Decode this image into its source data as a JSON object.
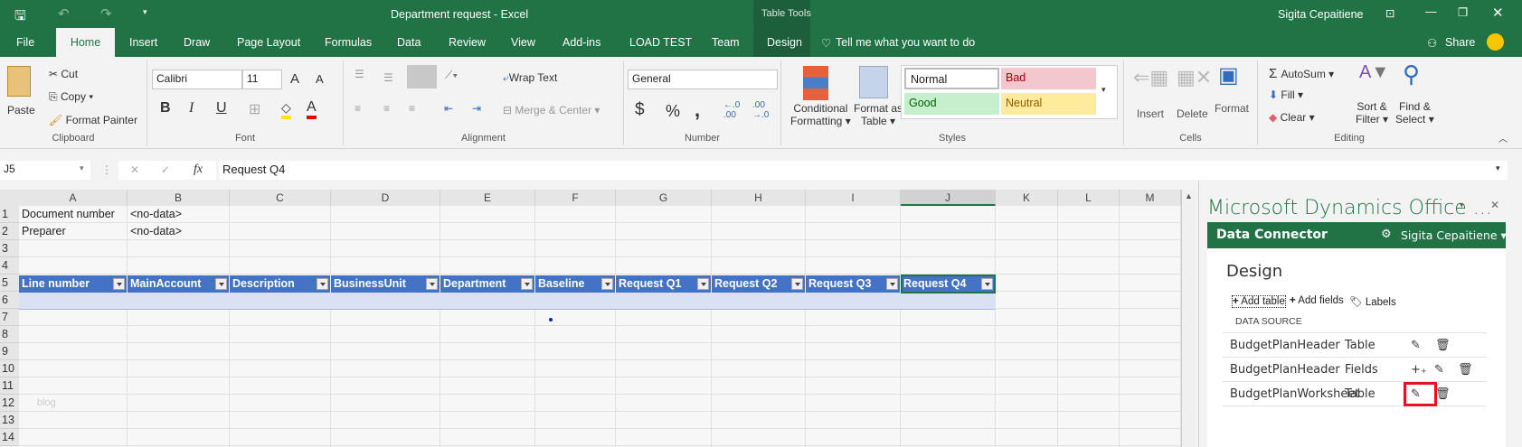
{
  "window": {
    "title": "Department request  -  Excel",
    "context_tab_group": "Table Tools",
    "user": "Sigita Cepaitiene",
    "share": "Share"
  },
  "tabs": [
    "File",
    "Home",
    "Insert",
    "Draw",
    "Page Layout",
    "Formulas",
    "Data",
    "Review",
    "View",
    "Add-ins",
    "LOAD TEST",
    "Team",
    "Design"
  ],
  "tell_me": "Tell me what you want to do",
  "ribbon": {
    "clipboard": {
      "label": "Clipboard",
      "paste": "Paste",
      "cut": "Cut",
      "copy": "Copy",
      "format_painter": "Format Painter"
    },
    "font": {
      "label": "Font",
      "name": "Calibri",
      "size": "11",
      "bold": "B",
      "italic": "I",
      "underline": "U"
    },
    "alignment": {
      "label": "Alignment",
      "wrap": "Wrap Text",
      "merge": "Merge & Center"
    },
    "number": {
      "label": "Number",
      "format": "General",
      "currency": "$",
      "percent": "%",
      "comma": ","
    },
    "styles": {
      "label": "Styles",
      "conditional": "Conditional",
      "conditional2": "Formatting",
      "format_table": "Format as",
      "format_table2": "Table",
      "normal": "Normal",
      "bad": "Bad",
      "good": "Good",
      "neutral": "Neutral"
    },
    "cells": {
      "label": "Cells",
      "insert": "Insert",
      "delete": "Delete",
      "format": "Format"
    },
    "editing": {
      "label": "Editing",
      "autosum": "AutoSum",
      "fill": "Fill",
      "clear": "Clear",
      "sort": "Sort &",
      "sort2": "Filter",
      "find": "Find &",
      "find2": "Select"
    }
  },
  "formula_bar": {
    "name_box": "J5",
    "fx": "fx",
    "value": "Request Q4"
  },
  "sheet": {
    "columns": [
      "A",
      "B",
      "C",
      "D",
      "E",
      "F",
      "G",
      "H",
      "I",
      "J",
      "K",
      "L",
      "M"
    ],
    "rows": [
      "1",
      "2",
      "3",
      "4",
      "5",
      "6",
      "7",
      "8",
      "9",
      "10",
      "11",
      "12",
      "13",
      "14"
    ],
    "a1": "Document number",
    "b1": "<no-data>",
    "a2": "Preparer",
    "b2": "<no-data>",
    "table_headers": [
      "Line number",
      "MainAccount",
      "Description",
      "BusinessUnit",
      "Department",
      "Baseline",
      "Request Q1",
      "Request Q2",
      "Request Q3",
      "Request Q4"
    ],
    "watermark": "blog"
  },
  "panel": {
    "title": "Microsoft Dynamics Office ...",
    "bar_title": "Data Connector",
    "user": "Sigita Cepaitiene",
    "heading": "Design",
    "add_table": "Add table",
    "add_fields": "Add fields",
    "labels": "Labels",
    "section": "DATA SOURCE",
    "rows": [
      {
        "name": "BudgetPlanHeader",
        "type": "Table"
      },
      {
        "name": "BudgetPlanHeader",
        "type": "Fields"
      },
      {
        "name": "BudgetPlanWorksheet",
        "type": "Table"
      }
    ]
  },
  "colors": {
    "excel_green": "#217346",
    "table_header": "#4472c4",
    "highlight": "#e81123"
  }
}
